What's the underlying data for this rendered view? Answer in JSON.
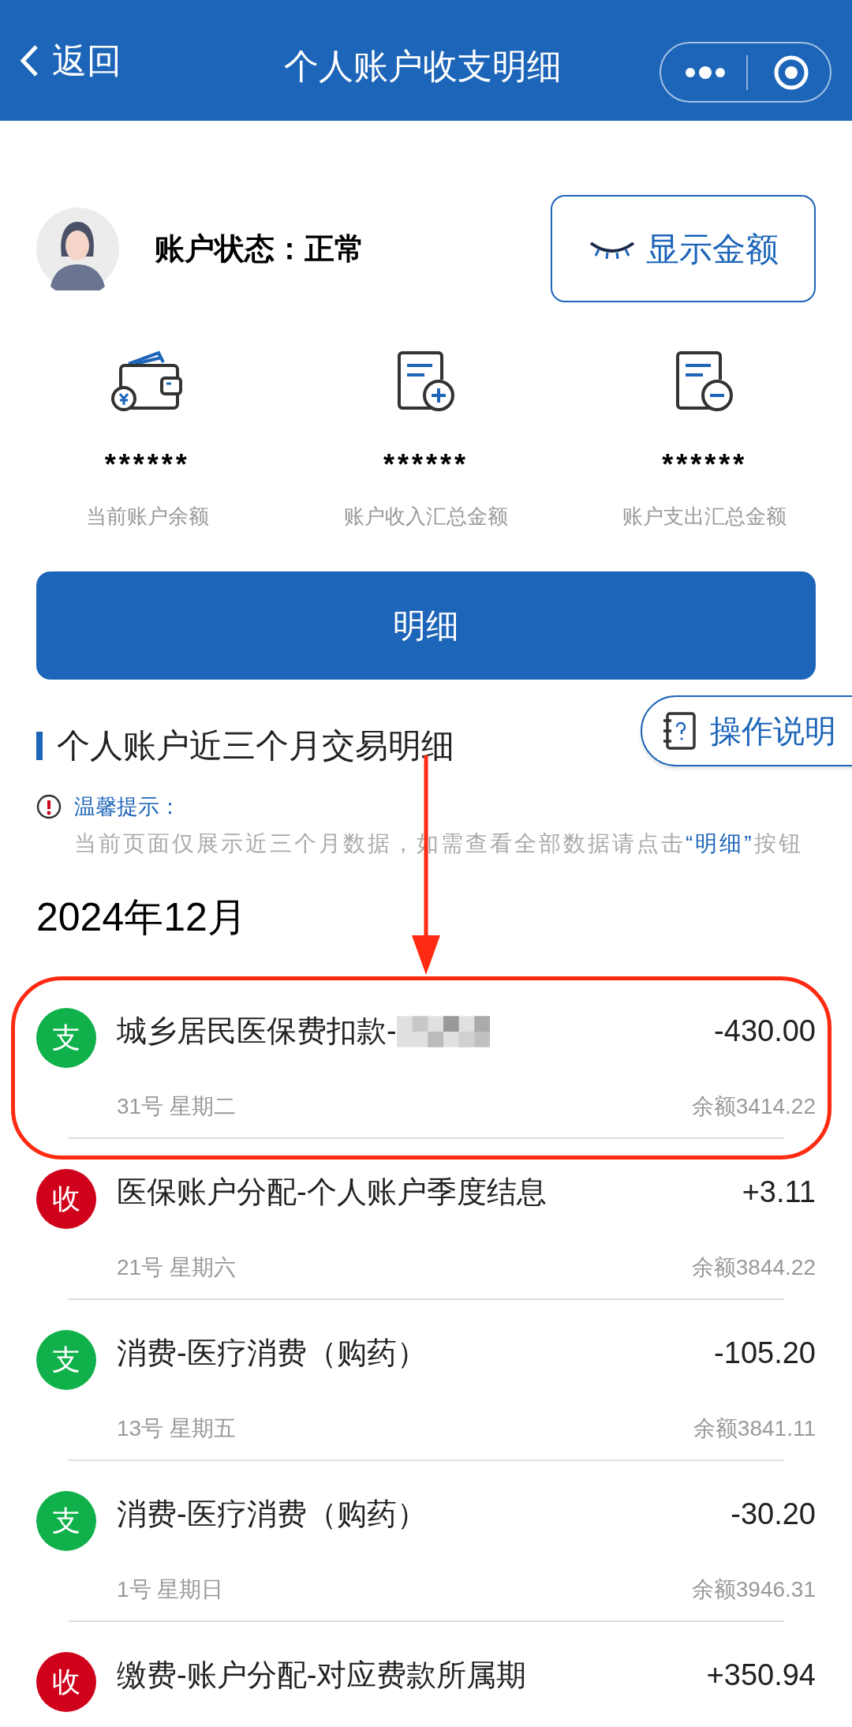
{
  "nav": {
    "back": "返回",
    "title": "个人账户收支明细"
  },
  "account": {
    "status": "账户状态：正常",
    "show_button": "显示金额"
  },
  "summary": [
    {
      "kind": "wallet",
      "value": "******",
      "label": "当前账户余额"
    },
    {
      "kind": "income",
      "value": "******",
      "label": "账户收入汇总金额"
    },
    {
      "kind": "expense",
      "value": "******",
      "label": "账户支出汇总金额"
    }
  ],
  "details_button": "明细",
  "help_button": "操作说明",
  "section_title": "个人账户近三个月交易明细",
  "notice": {
    "title": "温馨提示：",
    "text": "当前页面仅展示近三个月数据，如需查看全部数据请点击",
    "link": "“明细”",
    "text_after": "按钮"
  },
  "month": "2024年12月",
  "transactions": [
    {
      "color": "#10b04a",
      "badge": "支",
      "title": "城乡居民医保费扣款-",
      "redacted": true,
      "amount": "-430.00",
      "date": "31号 星期二",
      "balance": "余额3414.22",
      "highlighted": true
    },
    {
      "color": "#d0021b",
      "badge": "收",
      "title": "医保账户分配-个人账户季度结息",
      "redacted": false,
      "amount": "+3.11",
      "date": "21号 星期六",
      "balance": "余额3844.22",
      "highlighted": false
    },
    {
      "color": "#10b04a",
      "badge": "支",
      "title": "消费-医疗消费（购药）",
      "redacted": false,
      "amount": "-105.20",
      "date": "13号 星期五",
      "balance": "余额3841.11",
      "highlighted": false
    },
    {
      "color": "#10b04a",
      "badge": "支",
      "title": "消费-医疗消费（购药）",
      "redacted": false,
      "amount": "-30.20",
      "date": "1号 星期日",
      "balance": "余额3946.31",
      "highlighted": false
    },
    {
      "color": "#d0021b",
      "badge": "收",
      "title": "缴费-账户分配-对应费款所属期",
      "redacted": false,
      "amount": "+350.94",
      "highlighted": false
    }
  ]
}
